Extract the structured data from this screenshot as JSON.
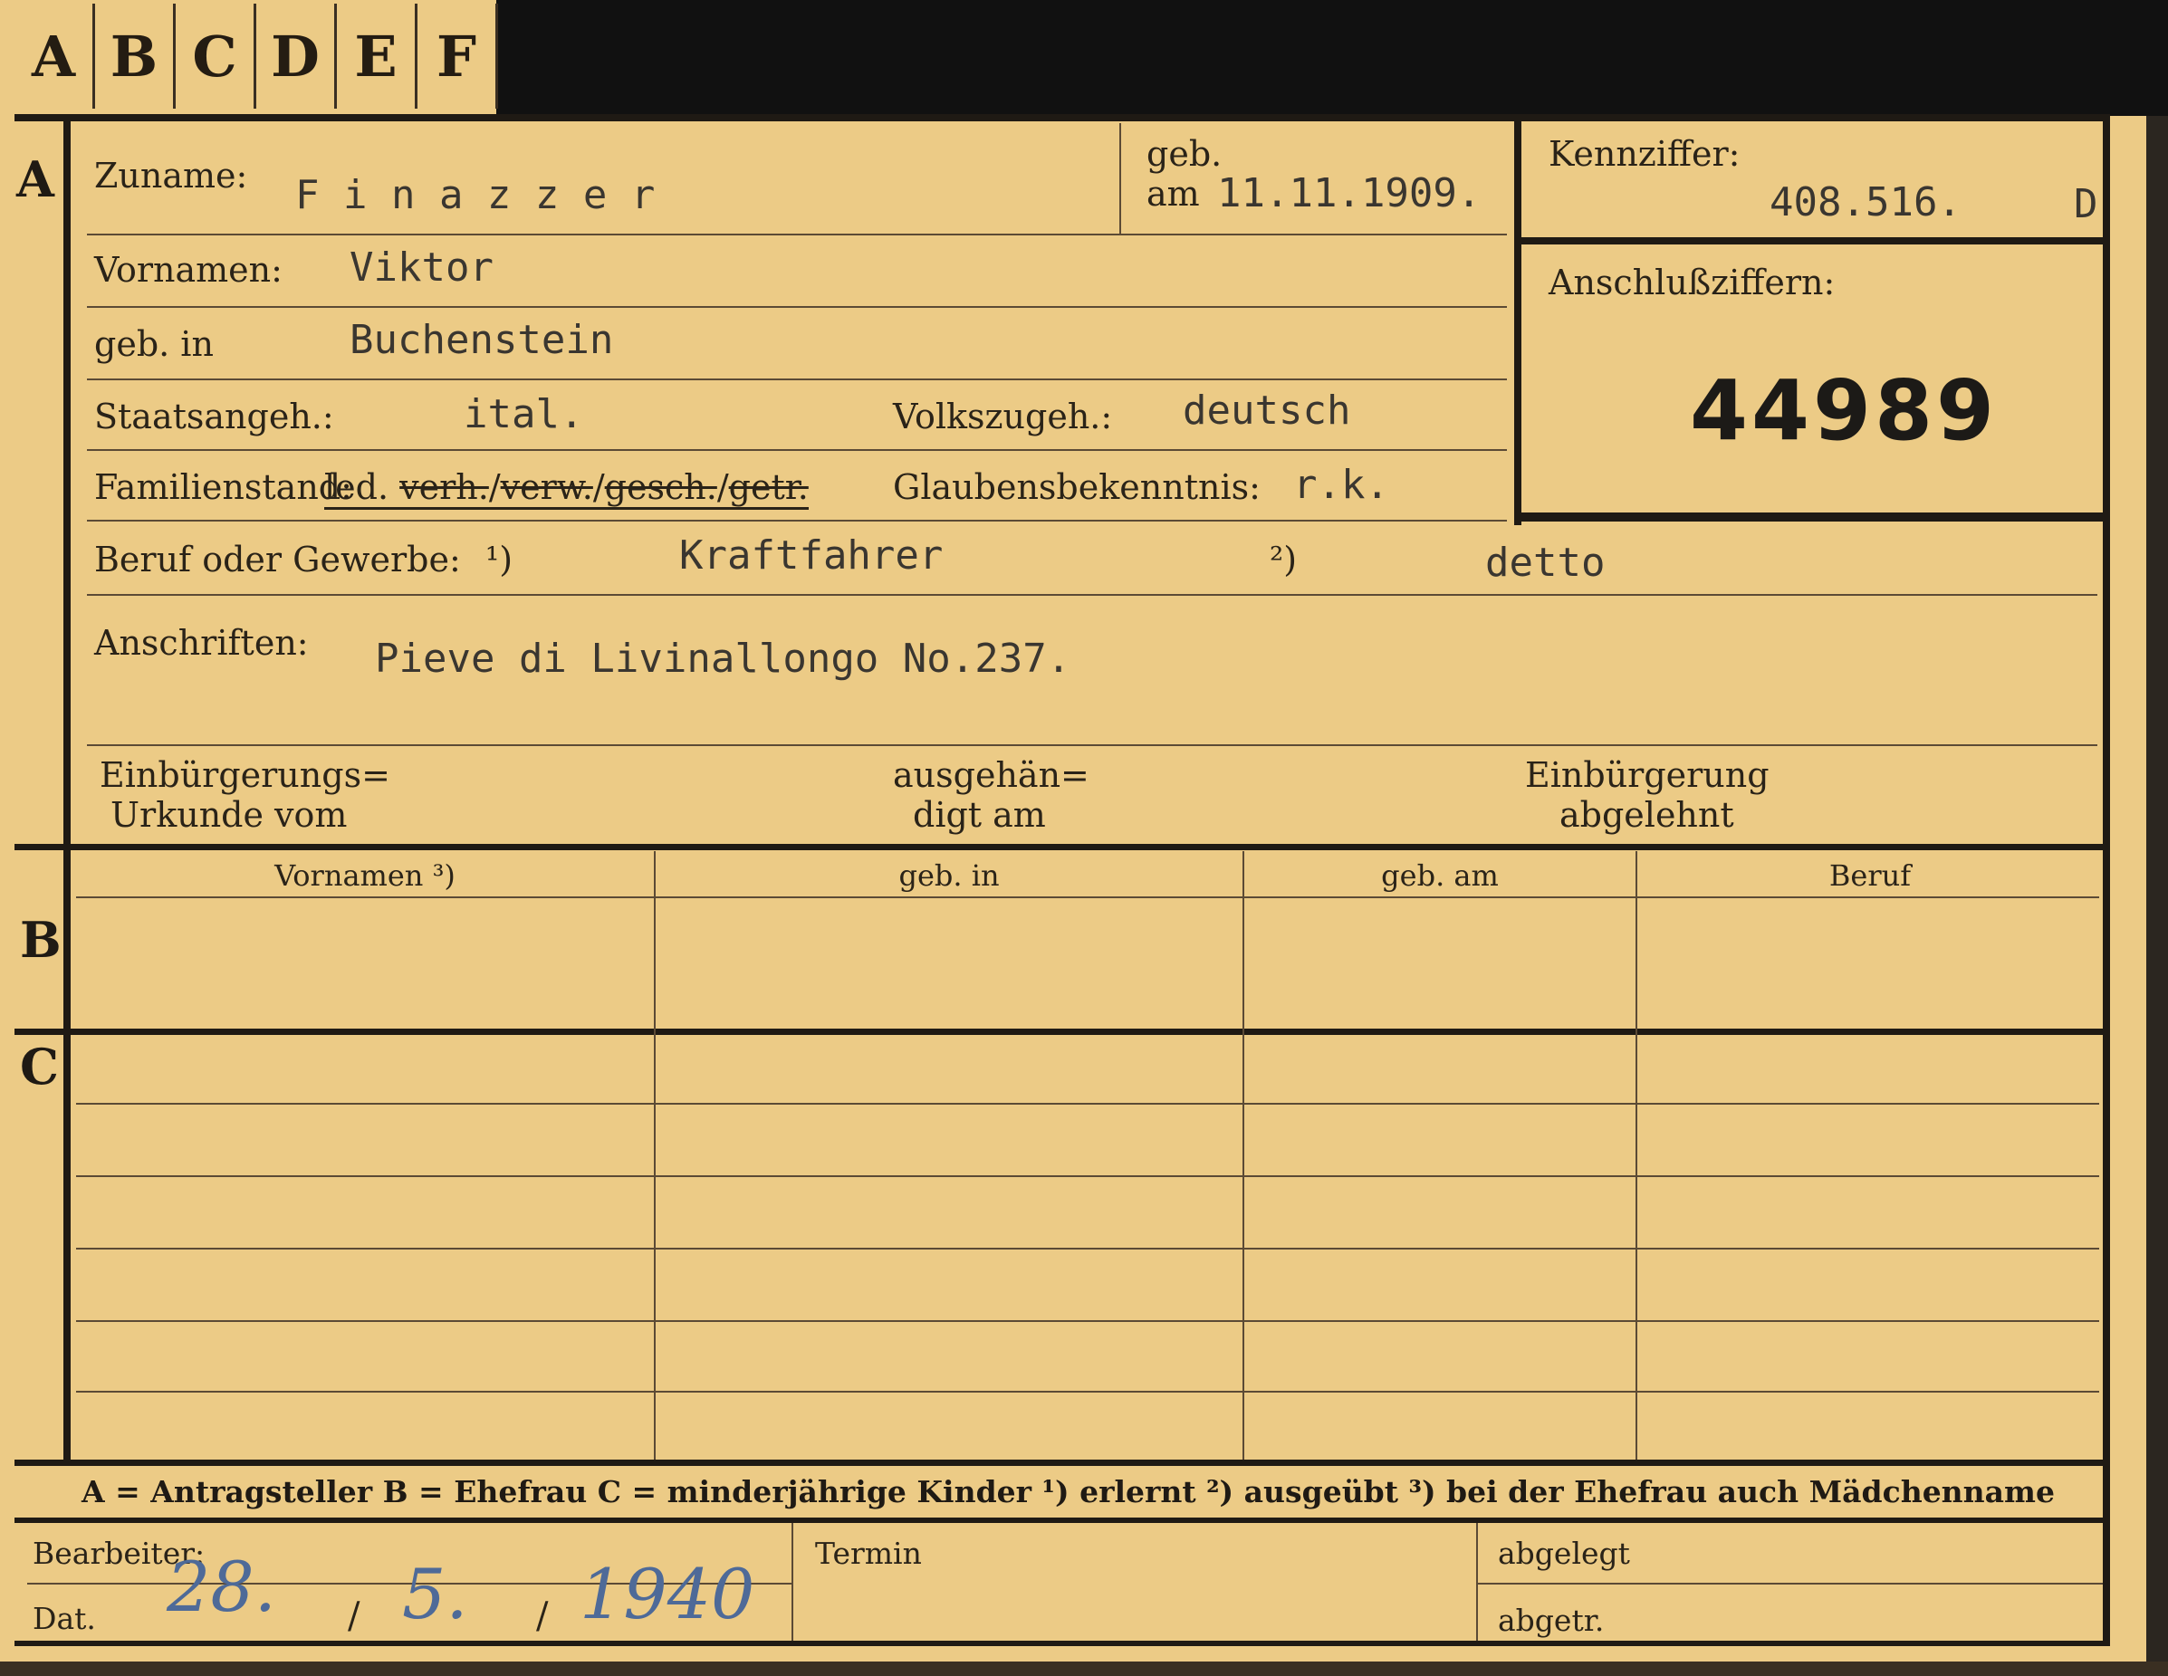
{
  "tabs": [
    "A",
    "B",
    "C",
    "D",
    "E",
    "F"
  ],
  "sections": {
    "a": "A",
    "b": "B",
    "c": "C"
  },
  "labels": {
    "zuname": "Zuname:",
    "geb_top": "geb.",
    "geb_am": "am",
    "kennziffer": "Kennziffer:",
    "anschluss": "Anschlußziffern:",
    "vornamen": "Vornamen:",
    "geb_in": "geb. in",
    "staats": "Staatsangeh.:",
    "volks": "Volkszugeh.:",
    "familienstand": "Familienstand:",
    "glauben": "Glaubensbekenntnis:",
    "beruf": "Beruf oder Gewerbe:",
    "beruf_fn1": "¹)",
    "beruf_fn2": "²)",
    "anschriften": "Anschriften:",
    "einb1": "Einbürgerungs=",
    "einb2": "Urkunde vom",
    "ausg1": "ausgehän=",
    "ausg2": "digt am",
    "abgel1": "Einbürgerung",
    "abgel2": "abgelehnt"
  },
  "family_options": {
    "led": "led.",
    "verh": "verh.",
    "verw": "verw.",
    "gesch": "gesch.",
    "getr": "getr."
  },
  "values": {
    "zuname": "F i n a z z e r",
    "geb_am": "11.11.1909.",
    "kennziffer": "408.516.",
    "kennziffer_suffix": "D",
    "anschluss": "44989",
    "vornamen": "Viktor",
    "geb_in": "Buchenstein",
    "staats": "ital.",
    "volks": "deutsch",
    "glauben": "r.k.",
    "beruf1": "Kraftfahrer",
    "beruf2": "detto",
    "anschriften": "Pieve di Livinallongo No.237."
  },
  "table_headers": [
    "Vornamen ³)",
    "geb. in",
    "geb. am",
    "Beruf"
  ],
  "legend": "A = Antragsteller   B = Ehefrau   C = minderjährige Kinder   ¹) erlernt   ²) ausgeübt   ³) bei der Ehefrau auch Mädchenname",
  "footer": {
    "bearbeiter": "Bearbeiter:",
    "dat": "Dat.",
    "termin": "Termin",
    "abgelegt": "abgelegt",
    "abgetr": "abgetr.",
    "date_day": "28.",
    "date_month": "5.",
    "date_year": "1940"
  }
}
